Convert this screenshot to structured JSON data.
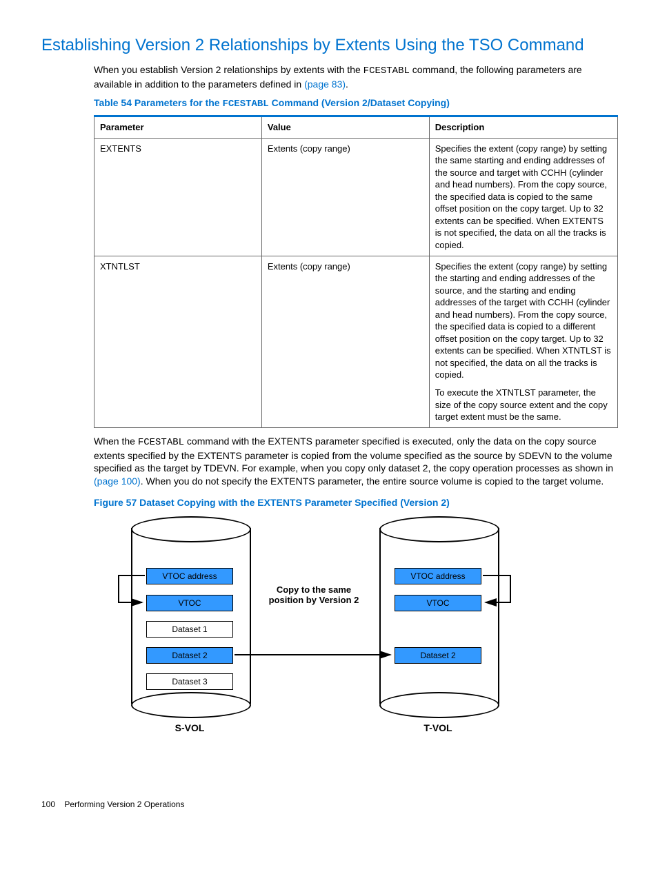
{
  "heading": "Establishing Version 2 Relationships by Extents Using the TSO Command",
  "intro": {
    "pre": "When you establish Version 2 relationships by extents with the ",
    "cmd1": "FCESTABL",
    "mid": " command, the following parameters are available in addition to the parameters defined in ",
    "link1": "(page 83)",
    "post": "."
  },
  "tableCaption": {
    "pre": "Table 54 Parameters for the ",
    "cmd": "FCESTABL",
    "post": " Command (Version 2/Dataset Copying)"
  },
  "table": {
    "headers": {
      "param": "Parameter",
      "value": "Value",
      "desc": "Description"
    },
    "rows": [
      {
        "param": "EXTENTS",
        "value": "Extents (copy range)",
        "desc": [
          "Specifies the extent (copy range) by setting the same starting and ending addresses of the source and target with CCHH (cylinder and head numbers). From the copy source, the specified data is copied to the same offset position on the copy target. Up to 32 extents can be specified. When EXTENTS is not specified, the data on all the tracks is copied."
        ]
      },
      {
        "param": "XTNTLST",
        "value": "Extents (copy range)",
        "desc": [
          "Specifies the extent (copy range) by setting the starting and ending addresses of the source, and the starting and ending addresses of the target with CCHH (cylinder and head numbers). From the copy source, the specified data is copied to a different offset position on the copy target. Up to 32 extents can be specified. When XTNTLST is not specified, the data on all the tracks is copied.",
          "To execute the XTNTLST parameter, the size of the copy source extent and the copy target extent must be the same."
        ]
      }
    ]
  },
  "para2": {
    "pre": "When the ",
    "cmd": "FCESTABL",
    "mid": " command with the EXTENTS parameter specified is executed, only the data on the copy source extents specified by the EXTENTS parameter is copied from the volume specified as the source by SDEVN to the volume specified as the target by TDEVN. For example, when you copy only dataset 2, the copy operation processes as shown in ",
    "link": "(page 100)",
    "post": ". When you do not specify the EXTENTS parameter, the entire source volume is copied to the target volume."
  },
  "figureCaption": "Figure 57 Dataset Copying with the EXTENTS Parameter Specified (Version 2)",
  "figure": {
    "svol": {
      "vtocAddr": "VTOC address",
      "vtoc": "VTOC",
      "ds1": "Dataset 1",
      "ds2": "Dataset 2",
      "ds3": "Dataset 3",
      "label": "S-VOL"
    },
    "tvol": {
      "vtocAddr": "VTOC address",
      "vtoc": "VTOC",
      "ds2": "Dataset 2",
      "label": "T-VOL"
    },
    "arrowText": "Copy to the same position by Version 2"
  },
  "footer": {
    "pageNum": "100",
    "section": "Performing Version 2 Operations"
  }
}
